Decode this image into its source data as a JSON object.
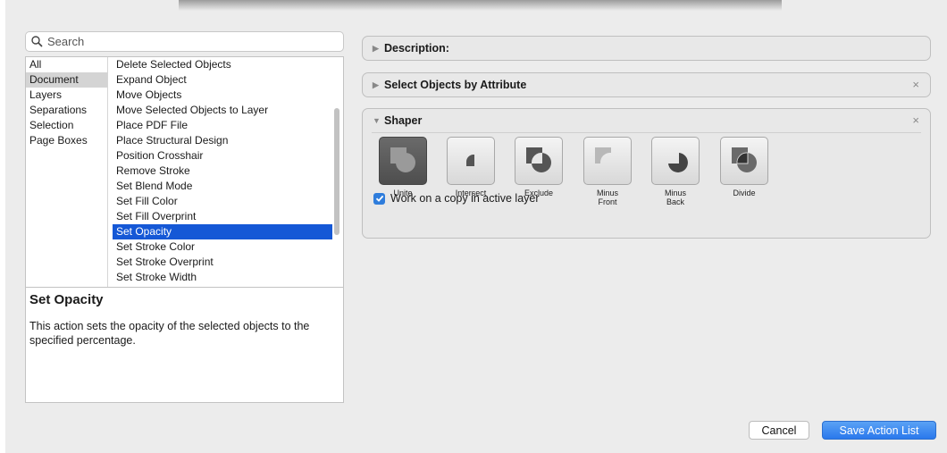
{
  "search": {
    "placeholder": "Search"
  },
  "categories": [
    "All",
    "Document",
    "Layers",
    "Separations",
    "Selection",
    "Page Boxes"
  ],
  "actions": [
    "Delete Selected Objects",
    "Expand Object",
    "Move Objects",
    "Move Selected Objects to Layer",
    "Place PDF File",
    "Place Structural Design",
    "Position Crosshair",
    "Remove Stroke",
    "Set Blend Mode",
    "Set Fill Color",
    "Set Fill Overprint",
    "Set Opacity",
    "Set Stroke Color",
    "Set Stroke Overprint",
    "Set Stroke Width"
  ],
  "selected_category": "Document",
  "selected_action": "Set Opacity",
  "description": {
    "title": "Set Opacity",
    "text": "This action sets the opacity of the selected objects to the specified percentage."
  },
  "panels": {
    "description": {
      "title": "Description:"
    },
    "select_by_attr": {
      "title": "Select Objects by Attribute",
      "close": "×"
    },
    "shaper": {
      "title": "Shaper",
      "close": "×",
      "operations": [
        {
          "label": "Unite",
          "icon": "unite-icon",
          "active": true
        },
        {
          "label": "Intersect",
          "icon": "intersect-icon",
          "active": false
        },
        {
          "label": "Exclude",
          "icon": "exclude-icon",
          "active": false
        },
        {
          "label": "Minus\nFront",
          "icon": "minus-front-icon",
          "active": false
        },
        {
          "label": "Minus\nBack",
          "icon": "minus-back-icon",
          "active": false
        },
        {
          "label": "Divide",
          "icon": "divide-icon",
          "active": false
        }
      ],
      "checkbox_label": "Work on a copy in active layer",
      "checkbox_checked": true
    }
  },
  "buttons": {
    "cancel": "Cancel",
    "save": "Save Action List"
  },
  "colors": {
    "accent": "#1558d6",
    "save_button": "#2a78ec",
    "checkbox": "#2f7ddc"
  }
}
